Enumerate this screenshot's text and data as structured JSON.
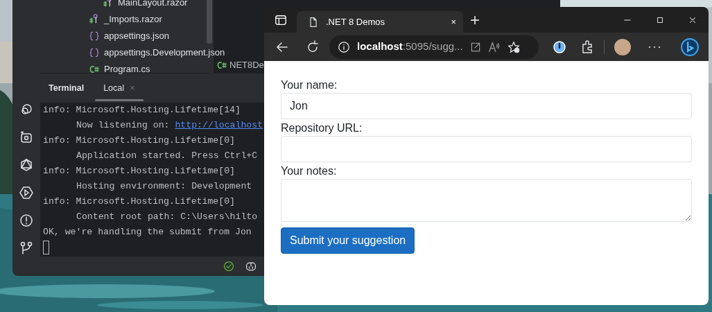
{
  "ide": {
    "file_tree": [
      {
        "label": "MainLayout.razor",
        "kind": "razor",
        "nested": true
      },
      {
        "label": "_Imports.razor",
        "kind": "razor",
        "nested": false
      },
      {
        "label": "appsettings.json",
        "kind": "json",
        "nested": false
      },
      {
        "label": "appsettings.Development.json",
        "kind": "json",
        "nested": false
      },
      {
        "label": "Program.cs",
        "kind": "csharp",
        "nested": false
      }
    ],
    "editor_tab": "NET8De",
    "terminal": {
      "tabs": [
        {
          "label": "Terminal",
          "selected": false
        },
        {
          "label": "Local",
          "selected": true
        }
      ],
      "close_label": "×",
      "lines": [
        {
          "text": "info: Microsoft.Hosting.Lifetime[14]",
          "children": [
            {
              "text": "Now listening on: ",
              "link": "http://localhost"
            }
          ]
        },
        {
          "text": "info: Microsoft.Hosting.Lifetime[0]",
          "children": [
            {
              "text": "Application started. Press Ctrl+C"
            }
          ]
        },
        {
          "text": "info: Microsoft.Hosting.Lifetime[0]",
          "children": [
            {
              "text": "Hosting environment: Development"
            }
          ]
        },
        {
          "text": "info: Microsoft.Hosting.Lifetime[0]",
          "children": [
            {
              "text": "Content root path: C:\\Users\\hilto"
            }
          ]
        },
        {
          "text": "OK, we're handling the submit from Jon"
        }
      ]
    }
  },
  "browser": {
    "tab": {
      "title": ".NET 8 Demos",
      "close": "×"
    },
    "new_tab": "+",
    "address": {
      "host": "localhost",
      "rest": ":5095/sugg..."
    },
    "more": "···",
    "form": {
      "fields": [
        {
          "label": "Your name:",
          "kind": "input",
          "value": "Jon"
        },
        {
          "label": "Repository URL:",
          "kind": "input"
        },
        {
          "label": "Your notes:",
          "kind": "textarea"
        }
      ],
      "submit": "Submit your suggestion"
    }
  }
}
